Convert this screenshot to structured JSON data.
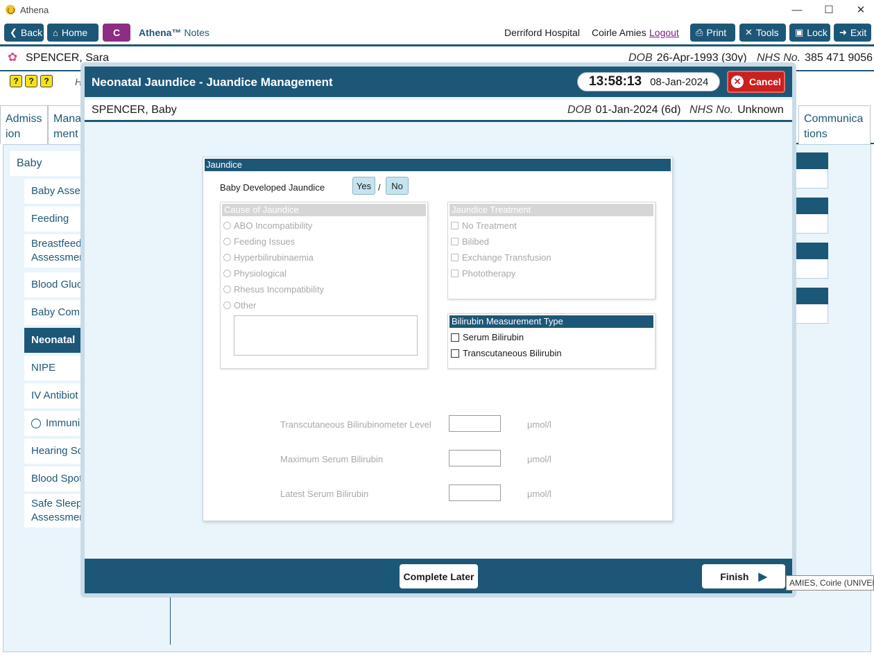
{
  "window": {
    "title": "Athena",
    "controls": [
      "—",
      "☐",
      "✕"
    ]
  },
  "toolbar": {
    "back_label": "Back",
    "home_label": "Home",
    "c_label": "C",
    "brand_name": "Athena™",
    "brand_suffix": "Notes",
    "hospital": "Derriford Hospital",
    "user": "Coirle Amies",
    "logout_label": "Logout",
    "print_label": "Print",
    "tools_label": "Tools",
    "lock_label": "Lock",
    "exit_label": "Exit"
  },
  "patient": {
    "name": "SPENCER, Sara",
    "dob_label": "DOB",
    "dob": "26-Apr-1993 (30y)",
    "nhs_label": "NHS No.",
    "nhs": "385 471 9056"
  },
  "yellow_icons": [
    "?",
    "?",
    "?"
  ],
  "h_letter": "H",
  "background_tabs": [
    {
      "label_line1": "Admiss",
      "label_line2": "ion"
    },
    {
      "label_line1": "Mana",
      "label_line2": "ment"
    },
    {
      "label_line1": "Communica",
      "label_line2": "tions"
    }
  ],
  "sidebar": {
    "heading": "Baby",
    "items": [
      {
        "label": "Baby Asses"
      },
      {
        "label": "Feeding"
      },
      {
        "label": "Breastfeedi",
        "label2": "Assessmen"
      },
      {
        "label": "Blood Gluc"
      },
      {
        "label": "Baby Comr"
      },
      {
        "label": "Neonatal",
        "active": true
      },
      {
        "label": "NIPE"
      },
      {
        "label": "IV Antibiot"
      },
      {
        "label": "Immunis"
      },
      {
        "label": "Hearing Sc"
      },
      {
        "label": "Blood Spot"
      },
      {
        "label": "Safe Sleepi",
        "label2": "Assessmen"
      }
    ]
  },
  "modal": {
    "title": "Neonatal Jaundice - Juandice Management",
    "time": "13:58:13",
    "date": "08-Jan-2024",
    "cancel_label": "Cancel",
    "baby_name": "SPENCER, Baby",
    "dob_label": "DOB",
    "dob": "01-Jan-2024 (6d)",
    "nhs_label": "NHS No.",
    "nhs": "Unknown",
    "panel": {
      "heading": "Jaundice",
      "question": "Baby Developed Jaundice",
      "yes_label": "Yes",
      "slash": "/",
      "no_label": "No",
      "cause": {
        "heading": "Cause of Jaundice",
        "options": [
          "ABO Incompatibility",
          "Feeding Issues",
          "Hyperbilirubinaemia",
          "Physiological",
          "Rhesus Incompatibility",
          "Other"
        ],
        "other_text": ""
      },
      "treatment": {
        "heading": "Jaundice Treatment",
        "options": [
          "No Treatment",
          "Bilibed",
          "Exchange Transfusion",
          "Phototherapy"
        ]
      },
      "measurement": {
        "heading": "Bilirubin Measurement Type",
        "options": [
          "Serum Bilirubin",
          "Transcutaneous Bilirubin"
        ]
      },
      "measures": [
        {
          "label": "Transcutaneous Bilirubinometer Level",
          "value": "",
          "unit": "μmol/l"
        },
        {
          "label": "Maximum Serum Bilirubin",
          "value": "",
          "unit": "μmol/l"
        },
        {
          "label": "Latest Serum Bilirubin",
          "value": "",
          "unit": "μmol/l"
        }
      ]
    },
    "complete_later_label": "Complete Later",
    "finish_label": "Finish"
  },
  "tooltip": "AMIES, Coirle (UNIVERS",
  "colors": {
    "navy": "#1d5777",
    "cancel_red": "#cc1f1f",
    "brand_purple": "#8d2d84",
    "panel_bg": "#e9f4fb"
  }
}
